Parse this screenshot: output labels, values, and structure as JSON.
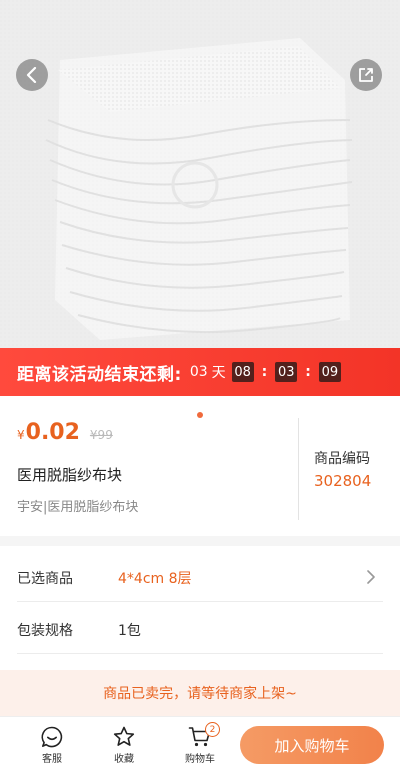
{
  "product_image": {
    "alt": "医用脱脂纱布块"
  },
  "countdown": {
    "title": "距离该活动结束还剩:",
    "days": "03",
    "day_unit": "天",
    "hours": "08",
    "minutes": "03",
    "seconds": "09",
    "separator": ":"
  },
  "product": {
    "currency": "¥",
    "price": "0.02",
    "original_price": "¥99",
    "name": "医用脱脂纱布块",
    "subtitle": "宇安|医用脱脂纱布块",
    "code_label": "商品编码",
    "code_value": "302804"
  },
  "specs": [
    {
      "label": "已选商品",
      "value": "4*4cm 8层"
    },
    {
      "label": "包装规格",
      "value": "1包"
    }
  ],
  "notice": "商品已卖完，请等待商家上架~",
  "bottom_bar": {
    "service_label": "客服",
    "favorite_label": "收藏",
    "cart_label": "购物车",
    "cart_count": "2",
    "add_to_cart_label": "加入购物车"
  },
  "colors": {
    "accent": "#e8621f",
    "banner": "#f33427",
    "timer_box": "#52201c",
    "cart_button": "#f2824a",
    "notice_bg": "#fdf0ea"
  }
}
